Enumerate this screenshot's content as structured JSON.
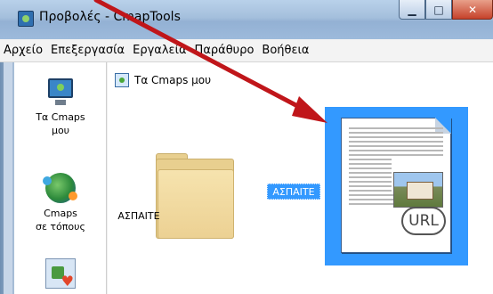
{
  "window": {
    "title": "Προβολές - CmapTools"
  },
  "menu": [
    "Αρχείο",
    "Επεξεργασία",
    "Εργαλεία",
    "Παράθυρο",
    "Βοήθεια"
  ],
  "sidebar": {
    "items": [
      {
        "label_line1": "Τα Cmaps",
        "label_line2": "μου",
        "icon": "computer-monitor-icon"
      },
      {
        "label_line1": "Cmaps",
        "label_line2": "σε τόπους",
        "icon": "network-globe-icon"
      },
      {
        "label_line1": "",
        "label_line2": "",
        "icon": "shared-cmaps-icon"
      }
    ]
  },
  "main": {
    "breadcrumb": "Τα Cmaps μου",
    "items": [
      {
        "name": "ΑΣΠΑΙΤΕ",
        "type": "folder",
        "selected": false
      },
      {
        "name": "ΑΣΠΑΙΤΕ",
        "type": "url-document",
        "badge": "URL",
        "selected": true
      }
    ]
  },
  "colors": {
    "selection": "#3399ff",
    "annotation_arrow": "#c0161a"
  }
}
